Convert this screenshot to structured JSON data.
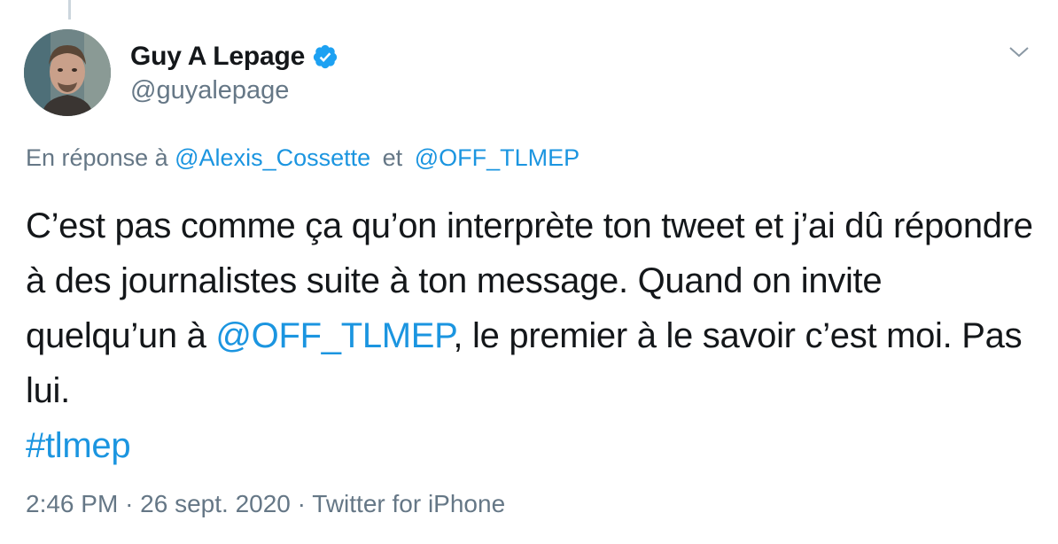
{
  "tweet": {
    "author": {
      "display_name": "Guy A Lepage",
      "handle": "@guyalepage",
      "verified": true,
      "avatar_icon": "user-avatar-photo"
    },
    "reply_context": {
      "prefix": "En réponse à",
      "mention_1": "@Alexis_Cossette",
      "connector": "et",
      "mention_2": "@OFF_TLMEP"
    },
    "body": {
      "text_part_1": "C’est pas comme ça qu’on interprète ton tweet et j’ai dû répondre à des journalistes suite à ton message. Quand on invite quelqu’un à ",
      "mention": "@OFF_TLMEP",
      "text_part_2": ", le premier à le savoir c’est moi. Pas lui.",
      "hashtag": "#tlmep"
    },
    "meta": {
      "time": "2:46 PM",
      "separator": "·",
      "date": "26 sept. 2020",
      "source": "Twitter for iPhone"
    },
    "menu_icon": "chevron-down-icon"
  },
  "colors": {
    "link": "#1b95e0",
    "secondary_text": "#657786",
    "primary_text": "#14171a",
    "verified_badge": "#1da1f2",
    "thread_line": "#ccd6dd"
  }
}
